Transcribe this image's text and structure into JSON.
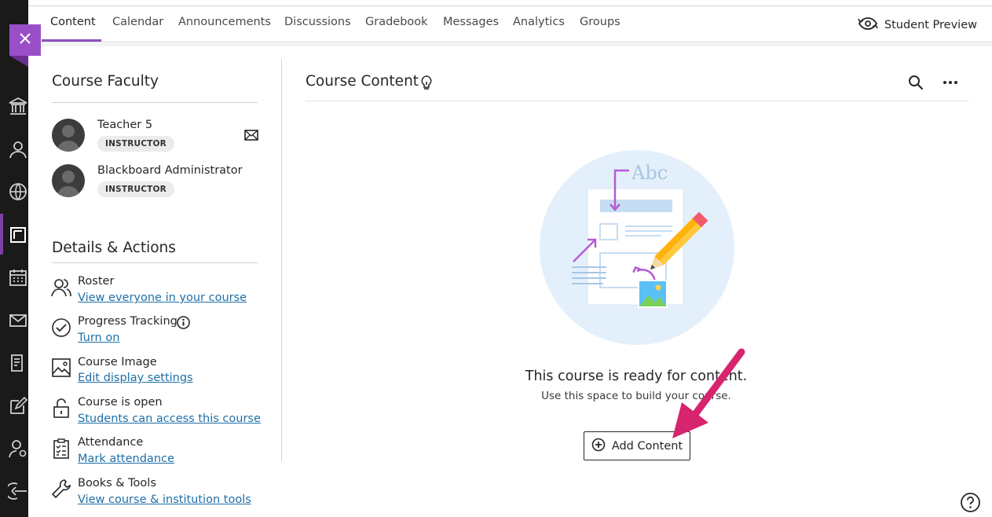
{
  "tabs": [
    {
      "label": "Content"
    },
    {
      "label": "Calendar"
    },
    {
      "label": "Announcements"
    },
    {
      "label": "Discussions"
    },
    {
      "label": "Gradebook"
    },
    {
      "label": "Messages"
    },
    {
      "label": "Analytics"
    },
    {
      "label": "Groups"
    }
  ],
  "header": {
    "preview_label": "Student Preview"
  },
  "faculty": {
    "title": "Course Faculty",
    "members": [
      {
        "name": "Teacher 5",
        "role": "INSTRUCTOR"
      },
      {
        "name": "Blackboard Administrator",
        "role": "INSTRUCTOR"
      }
    ]
  },
  "details": {
    "title": "Details & Actions",
    "items": [
      {
        "title": "Roster",
        "link": "View everyone in your course",
        "icon": "roster-icon"
      },
      {
        "title": "Progress Tracking",
        "link": "Turn on",
        "icon": "progress-check-icon"
      },
      {
        "title": "Course Image",
        "link": "Edit display settings",
        "icon": "image-icon"
      },
      {
        "title": "Course is open",
        "link": "Students can access this course",
        "icon": "unlock-icon"
      },
      {
        "title": "Attendance",
        "link": "Mark attendance",
        "icon": "attendance-icon"
      },
      {
        "title": "Books & Tools",
        "link": "View course & institution tools",
        "icon": "wrench-icon"
      }
    ]
  },
  "main": {
    "title": "Course Content",
    "illustration_text": "Abc",
    "empty_title": "This course is ready for content.",
    "empty_subtitle": "Use this space to build your course.",
    "add_button": "Add Content"
  },
  "colors": {
    "accent_purple": "#8e4fbf",
    "link_blue": "#1f6fa7",
    "annotation_arrow": "#d6246e",
    "rail": "#1a1a1a"
  }
}
